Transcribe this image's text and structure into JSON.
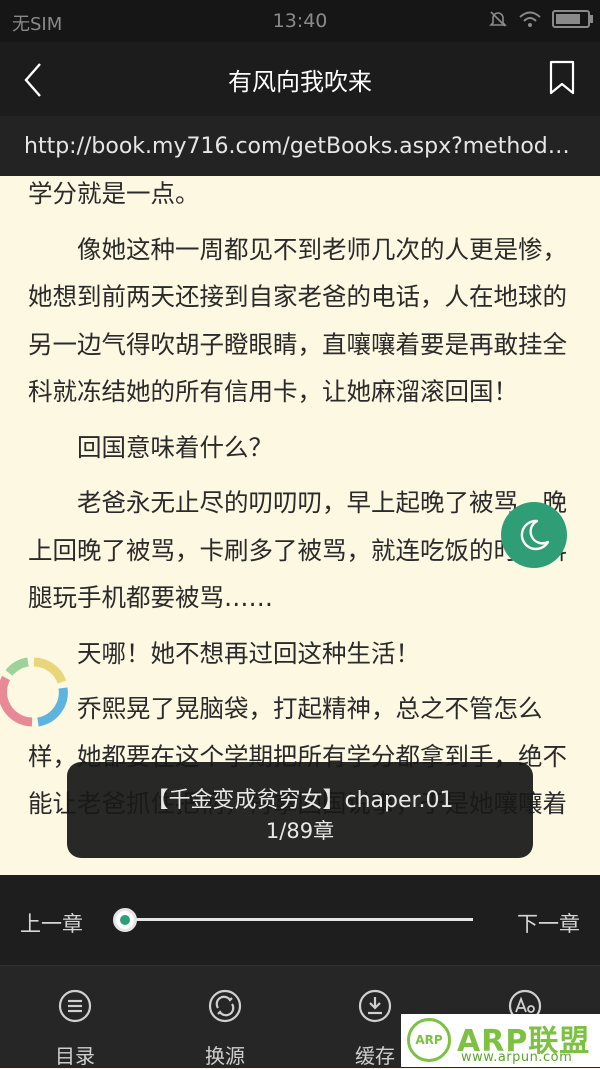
{
  "status_bar": {
    "carrier": "无SIM",
    "time": "13:40"
  },
  "header": {
    "title": "有风向我吹来"
  },
  "url_bar": {
    "url": "http://book.my716.com/getBooks.aspx?method=…"
  },
  "content": {
    "paragraphs": [
      "学分就是一点。",
      "像她这种一周都见不到老师几次的人更是惨，她想到前两天还接到自家老爸的电话，人在地球的另一边气得吹胡子瞪眼睛，直嚷嚷着要是再敢挂全科就冻结她的所有信用卡，让她麻溜滚回国！",
      "回国意味着什么？",
      "老爸永无止尽的叨叨叨，早上起晚了被骂，晚上回晚了被骂，卡刷多了被骂，就连吃饭的时候抖腿玩手机都要被骂……",
      "天哪！她不想再过回这种生活！",
      "乔熙晃了晃脑袋，打起精神，总之不管怎么样，她都要在这个学期把所有学分都拿到手，绝不能让老爸抓住把柄，再拿回国说事，于是她嚷嚷着"
    ]
  },
  "toast": {
    "chapter_title": "【千金变成贫穷女】chaper.01",
    "progress": "1/89章"
  },
  "chapter_nav": {
    "prev_label": "上一章",
    "next_label": "下一章",
    "progress_fraction": 0.0
  },
  "menu": {
    "items": [
      {
        "label": "目录",
        "icon": "list-icon"
      },
      {
        "label": "换源",
        "icon": "switch-source-icon"
      },
      {
        "label": "缓存",
        "icon": "download-icon"
      },
      {
        "label": "",
        "icon": "font-settings-icon"
      }
    ]
  },
  "watermark": {
    "badge": "ARP",
    "brand": "ARP联盟",
    "site": "www.arpun.com"
  },
  "colors": {
    "accent": "#2f9e76",
    "page_background": "#fdf8e2",
    "toolbar": "#1c1c1c"
  }
}
